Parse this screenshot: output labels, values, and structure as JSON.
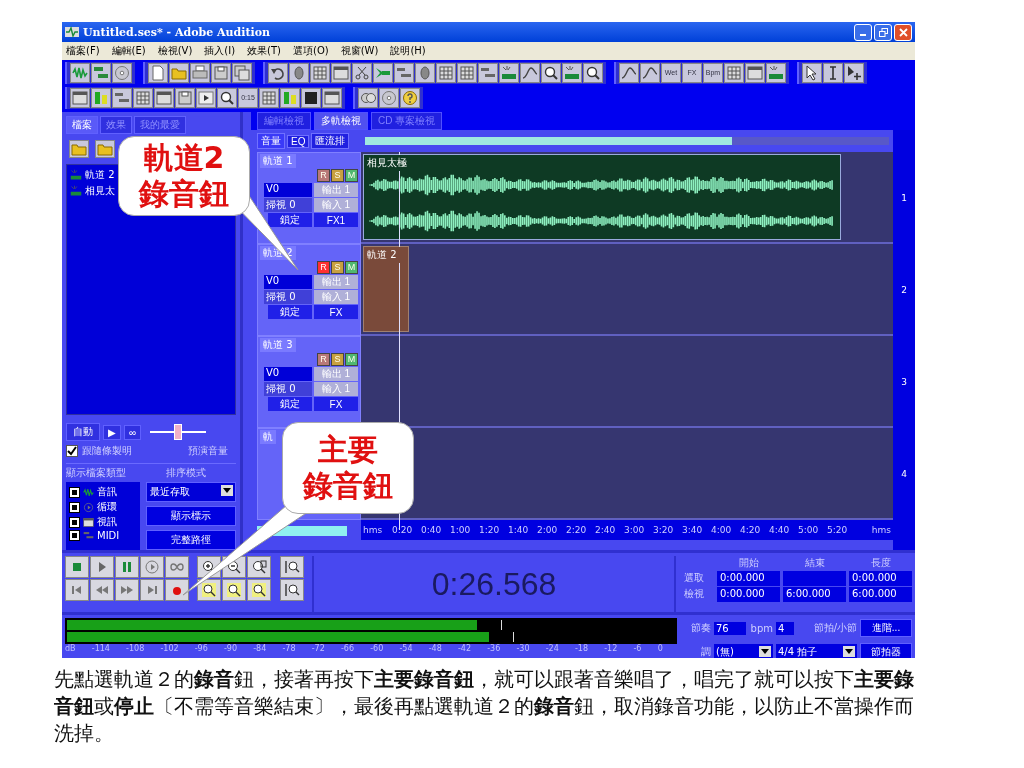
{
  "window": {
    "title": "Untitled.ses* - Adobe Audition"
  },
  "menu": [
    "檔案(F)",
    "編輯(E)",
    "檢視(V)",
    "插入(I)",
    "效果(T)",
    "選項(O)",
    "視窗(W)",
    "說明(H)"
  ],
  "toolbar": {
    "labeled_icons": [
      "Wet",
      "FX",
      "Bpm"
    ],
    "view_icon_label": "0:15"
  },
  "file_panel": {
    "tabs": [
      {
        "label": "檔案",
        "selected": true
      },
      {
        "label": "效果",
        "selected": false
      },
      {
        "label": "我的最愛",
        "selected": false
      }
    ],
    "files": [
      {
        "name": "軌道 2"
      },
      {
        "name": "相見太"
      }
    ],
    "auto_button": "自動",
    "play_button": "▶",
    "loop_button": "∞",
    "preview_volume": {
      "label": "預演音量",
      "level": 0.5
    },
    "follow_checkbox": {
      "label": "跟隨條製明",
      "checked": true
    },
    "file_types_label": "顯示檔案類型",
    "file_types": [
      {
        "label": "音訊",
        "checked": true,
        "kind": "audio"
      },
      {
        "label": "循環",
        "checked": true,
        "kind": "loop"
      },
      {
        "label": "視訊",
        "checked": true,
        "kind": "video"
      },
      {
        "label": "MIDI",
        "checked": true,
        "kind": "midi"
      }
    ],
    "sort_label": "排序模式",
    "sort_value": "最近存取",
    "buttons": [
      "顯示標示",
      "完整路徑"
    ]
  },
  "view_tabs": [
    {
      "label": "編輯檢視",
      "selected": false
    },
    {
      "label": "多軌檢視",
      "selected": true
    },
    {
      "label": "CD 專案檢視",
      "selected": false
    }
  ],
  "mixer_tabs": [
    {
      "label": "音量",
      "selected": true
    },
    {
      "label": "EQ",
      "selected": false
    },
    {
      "label": "匯流排",
      "selected": false
    }
  ],
  "tracks": [
    {
      "name": "軌道 1",
      "number": "1",
      "buttons": [
        {
          "label": "R",
          "kind": "record",
          "on": false
        },
        {
          "label": "S",
          "kind": "solo",
          "on": false
        },
        {
          "label": "M",
          "kind": "mute",
          "on": false
        }
      ],
      "volume": "V0",
      "output": "輸出 1",
      "pan": "掃視 0",
      "input": "輸入 1",
      "lock": "鎖定",
      "fx": "FX1",
      "clip": {
        "label": "相見太極",
        "kind": "wave"
      }
    },
    {
      "name": "軌道 2",
      "number": "2",
      "buttons": [
        {
          "label": "R",
          "kind": "record",
          "on": true
        },
        {
          "label": "S",
          "kind": "solo",
          "on": false
        },
        {
          "label": "M",
          "kind": "mute",
          "on": false
        }
      ],
      "volume": "V0",
      "output": "輸出 1",
      "pan": "掃視 0",
      "input": "輸入 1",
      "lock": "鎖定",
      "fx": "FX",
      "clip": {
        "label": "軌道 2",
        "kind": "empty"
      }
    },
    {
      "name": "軌道 3",
      "number": "3",
      "buttons": [
        {
          "label": "R",
          "kind": "record",
          "on": false
        },
        {
          "label": "S",
          "kind": "solo",
          "on": false
        },
        {
          "label": "M",
          "kind": "mute",
          "on": false
        }
      ],
      "volume": "V0",
      "output": "輸出 1",
      "pan": "掃視 0",
      "input": "輸入 1",
      "lock": "鎖定",
      "fx": "FX"
    },
    {
      "name": "軌",
      "number": "4"
    }
  ],
  "ruler": [
    "hms",
    "0:20",
    "0:40",
    "1:00",
    "1:20",
    "1:40",
    "2:00",
    "2:20",
    "2:40",
    "3:00",
    "3:20",
    "3:40",
    "4:00",
    "4:20",
    "4:40",
    "5:00",
    "5:20",
    "hms"
  ],
  "time": "0:26.568",
  "selection": {
    "headers": [
      "開始",
      "結束",
      "長度"
    ],
    "rows": [
      {
        "label": "選取",
        "start": "0:00.000",
        "length": "0:00.000"
      },
      {
        "label": "檢視",
        "start": "0:00.000",
        "end": "6:00.000",
        "length": "6:00.000"
      }
    ]
  },
  "meter": {
    "channels": [
      {
        "level": 0.69
      },
      {
        "level": 0.71
      }
    ],
    "scale": [
      "dB",
      "-114",
      "-108",
      "-102",
      "-96",
      "-90",
      "-84",
      "-78",
      "-72",
      "-66",
      "-60",
      "-54",
      "-48",
      "-42",
      "-36",
      "-30",
      "-24",
      "-18",
      "-12",
      "-6",
      "0"
    ]
  },
  "tempo": {
    "tempo_label": "節奏",
    "bpm": "76",
    "bpm_unit": "bpm",
    "beats": "4",
    "beats_unit": "節拍/小節",
    "advanced_button": "進階...",
    "key_label": "調",
    "key": "(無)",
    "meter": "4/4 拍子",
    "metronome_button": "節拍器"
  },
  "callouts": [
    {
      "lines": [
        "軌道2",
        "錄音鈕"
      ]
    },
    {
      "lines": [
        "主要",
        "錄音鈕"
      ]
    }
  ],
  "caption": "先點選軌道２的**錄音**鈕，接著再按下**主要錄音鈕**，就可以跟著音樂唱了，唱完了就可以按下**主要錄音鈕**或**停止**〔不需等音樂結束〕，最後再點選軌道２的**錄音**鈕，取消錄音功能，以防止不當操作而洗掉。"
}
